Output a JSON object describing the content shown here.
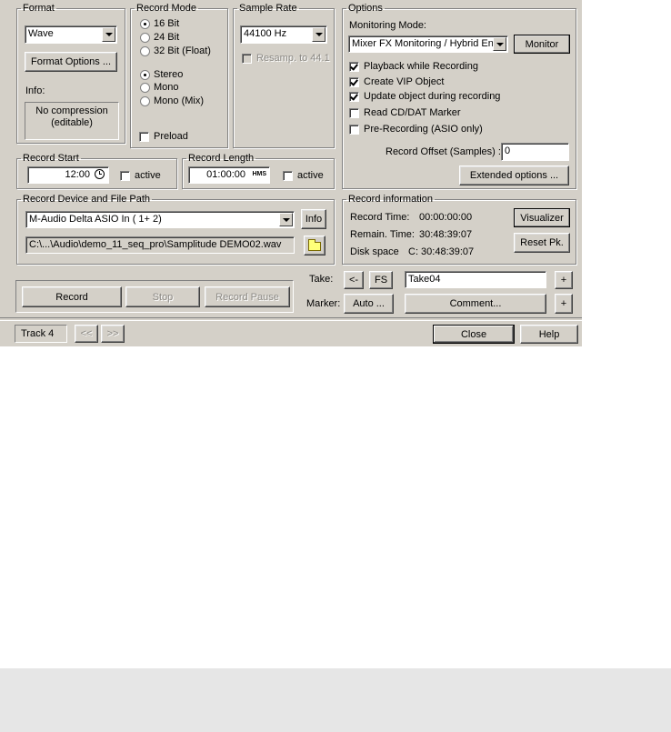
{
  "format": {
    "group_label": "Format",
    "format_value": "Wave",
    "options_button": "Format Options ...",
    "info_label": "Info:",
    "info_text_line1": "No compression",
    "info_text_line2": "(editable)"
  },
  "record_mode": {
    "group_label": "Record Mode",
    "bit_options": [
      "16 Bit",
      "24 Bit",
      "32 Bit (Float)"
    ],
    "bit_selected": 0,
    "channel_options": [
      "Stereo",
      "Mono",
      "Mono (Mix)"
    ],
    "channel_selected": 0,
    "preload_label": "Preload",
    "preload_checked": false
  },
  "sample_rate": {
    "group_label": "Sample Rate",
    "value": "44100 Hz",
    "resamp_label": "Resamp. to 44.1"
  },
  "options": {
    "group_label": "Options",
    "monitoring_label": "Monitoring Mode:",
    "monitoring_value": "Mixer FX Monitoring / Hybrid Eng",
    "monitor_button": "Monitor",
    "checkboxes": [
      {
        "label": "Playback while Recording",
        "checked": true
      },
      {
        "label": "Create VIP Object",
        "checked": true
      },
      {
        "label": "Update object during recording",
        "checked": true
      },
      {
        "label": "Read CD/DAT Marker",
        "checked": false
      },
      {
        "label": "Pre-Recording (ASIO only)",
        "checked": false
      }
    ],
    "offset_label": "Record Offset (Samples) :",
    "offset_value": "0",
    "extended_button": "Extended options ..."
  },
  "record_start": {
    "group_label": "Record Start",
    "time": "12:00",
    "active_label": "active"
  },
  "record_length": {
    "group_label": "Record Length",
    "time": "01:00:00",
    "unit": "HMS",
    "active_label": "active"
  },
  "device": {
    "group_label": "Record Device and File Path",
    "device_value": "M-Audio Delta ASIO In ( 1+ 2)",
    "info_button": "Info",
    "path": "C:\\...\\Audio\\demo_11_seq_pro\\Samplitude DEMO02.wav"
  },
  "record_info": {
    "group_label": "Record information",
    "record_time_label": "Record Time:",
    "record_time": "00:00:00:00",
    "remain_label": "Remain. Time:",
    "remain_time": "30:48:39:07",
    "disk_label": "Disk space",
    "disk_value": "C:  30:48:39:07",
    "visualizer_button": "Visualizer",
    "reset_button": "Reset Pk."
  },
  "transport": {
    "record": "Record",
    "stop": "Stop",
    "pause": "Record Pause"
  },
  "take": {
    "take_label": "Take:",
    "back_button": "<-",
    "fs_button": "FS",
    "take_value": "Take04",
    "plus": "+",
    "marker_label": "Marker:",
    "auto_button": "Auto ...",
    "comment_button": "Comment...",
    "plus2": "+"
  },
  "status": {
    "track": "Track 4",
    "prev": "<<",
    "next": ">>",
    "close": "Close",
    "help": "Help"
  }
}
